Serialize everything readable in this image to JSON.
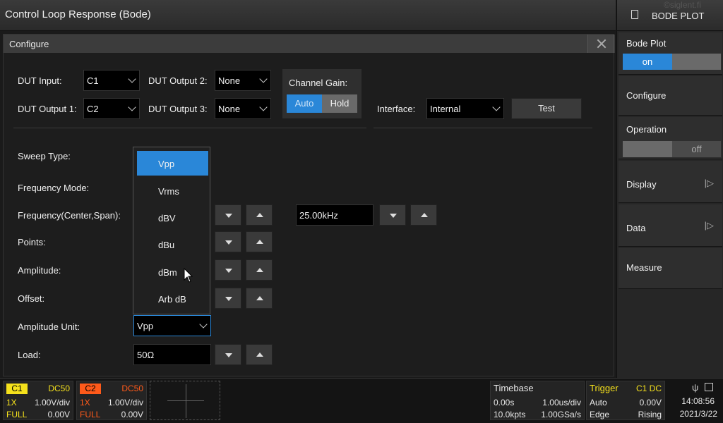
{
  "app": {
    "title": "Control Loop Response (Bode)",
    "watermark": "©siglent.fi"
  },
  "menu": {
    "header": "BODE PLOT",
    "bode_plot": {
      "label": "Bode Plot",
      "on": "on",
      "off": ""
    },
    "configure": "Configure",
    "operation": {
      "label": "Operation",
      "on": "",
      "off": "off"
    },
    "display": "Display",
    "data": "Data",
    "measure": "Measure"
  },
  "dialog": {
    "title": "Configure",
    "dut_input": {
      "label": "DUT Input:",
      "value": "C1"
    },
    "dut_output1": {
      "label": "DUT Output 1:",
      "value": "C2"
    },
    "dut_output2": {
      "label": "DUT Output 2:",
      "value": "None"
    },
    "dut_output3": {
      "label": "DUT Output 3:",
      "value": "None"
    },
    "channel_gain": {
      "label": "Channel Gain:",
      "auto": "Auto",
      "hold": "Hold"
    },
    "interface": {
      "label": "Interface:",
      "value": "Internal",
      "test": "Test"
    },
    "sweep_type": {
      "label": "Sweep Type:"
    },
    "frequency_mode": {
      "label": "Frequency Mode:"
    },
    "frequency": {
      "label": "Frequency(Center,Span):",
      "span_value": "25.00kHz"
    },
    "points": {
      "label": "Points:"
    },
    "amplitude": {
      "label": "Amplitude:"
    },
    "offset": {
      "label": "Offset:"
    },
    "amplitude_unit": {
      "label": "Amplitude Unit:",
      "value": "Vpp"
    },
    "load": {
      "label": "Load:",
      "value": "50Ω"
    },
    "unit_options": [
      "Vpp",
      "Vrms",
      "dBV",
      "dBu",
      "dBm",
      "Arb dB"
    ]
  },
  "status": {
    "c1": {
      "tag": "C1",
      "coupling": "DC50",
      "probe": "1X",
      "scale": "1.00V/div",
      "bw": "FULL",
      "offset": "0.00V",
      "color": "#f5e11c"
    },
    "c2": {
      "tag": "C2",
      "coupling": "DC50",
      "probe": "1X",
      "scale": "1.00V/div",
      "bw": "FULL",
      "offset": "0.00V",
      "color": "#ff5a1a"
    },
    "timebase": {
      "label": "Timebase",
      "delay": "0.00s",
      "scale": "1.00us/div",
      "points": "10.0kpts",
      "rate": "1.00GSa/s"
    },
    "trigger": {
      "label": "Trigger",
      "source": "C1 DC",
      "mode": "Auto",
      "level": "0.00V",
      "type": "Edge",
      "slope": "Rising"
    },
    "clock": {
      "time": "14:08:56",
      "date": "2021/3/22"
    }
  }
}
